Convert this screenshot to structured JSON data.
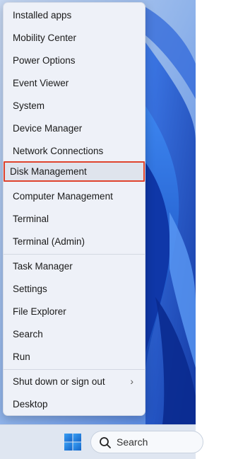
{
  "menu": {
    "items": [
      {
        "label": "Installed apps"
      },
      {
        "label": "Mobility Center"
      },
      {
        "label": "Power Options"
      },
      {
        "label": "Event Viewer"
      },
      {
        "label": "System"
      },
      {
        "label": "Device Manager"
      },
      {
        "label": "Network Connections"
      },
      {
        "label": "Disk Management",
        "selected": true
      },
      {
        "label": "Computer Management"
      },
      {
        "label": "Terminal"
      },
      {
        "label": "Terminal (Admin)"
      },
      {
        "label": "Task Manager"
      },
      {
        "label": "Settings"
      },
      {
        "label": "File Explorer"
      },
      {
        "label": "Search"
      },
      {
        "label": "Run"
      },
      {
        "label": "Shut down or sign out",
        "has_submenu": true
      },
      {
        "label": "Desktop"
      }
    ],
    "submenu_icon": "chevron-right-icon",
    "highlight_color": "#e0442e"
  },
  "taskbar": {
    "start_icon": "windows-logo-icon",
    "search_placeholder": "Search",
    "search_icon": "search-icon",
    "accent_color": "#1e7fd8"
  },
  "colors": {
    "menu_background": "#eef1f8",
    "wallpaper_blue": "#1f5fd6"
  }
}
